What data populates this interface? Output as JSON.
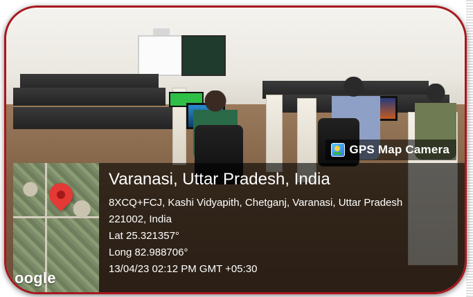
{
  "overlay": {
    "brand": "GPS Map Camera",
    "brand_icon": "gps-camera-app-icon",
    "title": "Varanasi, Uttar Pradesh, India",
    "address_line1": "8XCQ+FCJ, Kashi Vidyapith, Chetganj, Varanasi, Uttar Pradesh",
    "address_line2": "221002, India",
    "latitude": "Lat 25.321357°",
    "longitude": "Long 82.988706°",
    "timestamp": "13/04/23 02:12 PM GMT +05:30",
    "map_label": "oogle",
    "pin_icon": "map-pin-icon"
  },
  "colors": {
    "frame_border": "#a9161d",
    "pin": "#e53935",
    "overlay_bg": "rgba(0,0,0,0.60)",
    "text": "#ffffff"
  }
}
